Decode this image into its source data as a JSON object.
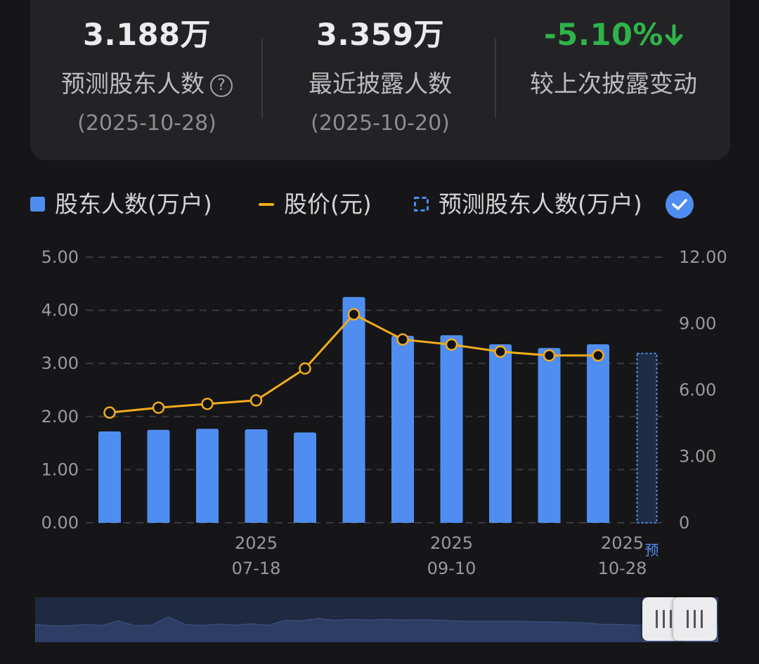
{
  "summary": {
    "forecast_holders": {
      "value": "3.188万",
      "label": "预测股东人数",
      "date": "(2025-10-28)",
      "help_icon": "question-circle-icon"
    },
    "latest_disclosed": {
      "value": "3.359万",
      "label": "最近披露人数",
      "date": "(2025-10-20)"
    },
    "change": {
      "value": "-5.10%",
      "label": "较上次披露变动",
      "icon": "arrow-down-icon",
      "color": "#2fb34a"
    }
  },
  "legend": {
    "bar_label": "股东人数(万户)",
    "line_label": "股价(元)",
    "forecast_label": "预测股东人数(万户)",
    "toggle_icon": "check-icon"
  },
  "colors": {
    "bar": "#4f8ef0",
    "line": "#f2ac1c",
    "forecast": "#4f8ef0",
    "toggle": "#4f8ef0"
  },
  "chart_data": {
    "type": "bar",
    "left_axis": {
      "ticks": [
        "5.00",
        "4.00",
        "3.00",
        "2.00",
        "1.00",
        "0.00"
      ],
      "ylim": [
        0,
        5
      ]
    },
    "right_axis": {
      "ticks": [
        "12.00",
        "9.00",
        "6.00",
        "3.00",
        "0"
      ],
      "ylim": [
        0,
        12
      ]
    },
    "x_labels": [
      {
        "year": "2025",
        "date": "07-18",
        "index": 3
      },
      {
        "year": "2025",
        "date": "09-10",
        "index": 7
      },
      {
        "year": "2025",
        "date": "10-28",
        "index": 11,
        "forecast_tag": "预"
      }
    ],
    "grid": true,
    "series": [
      {
        "name": "股东人数(万户)",
        "type": "bar",
        "values": [
          1.72,
          1.75,
          1.77,
          1.76,
          1.7,
          4.25,
          3.52,
          3.53,
          3.36,
          3.29,
          3.36
        ]
      },
      {
        "name": "股价(元)",
        "type": "line",
        "axis": "right",
        "values": [
          4.98,
          5.2,
          5.37,
          5.53,
          6.97,
          9.42,
          8.28,
          8.05,
          7.73,
          7.56,
          7.56
        ]
      },
      {
        "name": "预测股东人数(万户)",
        "type": "bar-forecast",
        "values": [
          null,
          null,
          null,
          null,
          null,
          null,
          null,
          null,
          null,
          null,
          null,
          3.188
        ]
      }
    ]
  },
  "navigator": {
    "area_values": [
      0.62,
      0.55,
      0.55,
      0.62,
      0.56,
      0.8,
      0.55,
      0.58,
      1.0,
      0.62,
      0.56,
      0.64,
      0.58,
      0.65,
      0.57,
      0.82,
      0.8,
      0.92,
      0.82,
      0.88,
      0.83,
      0.88,
      0.84,
      0.85,
      0.84,
      0.8,
      0.78,
      0.78,
      0.78,
      0.78,
      0.76,
      0.74,
      0.72,
      0.7,
      0.62,
      0.62,
      0.58,
      0.58,
      0.55,
      0.52,
      0.5,
      0.5
    ],
    "window_fraction": [
      0.89,
      1.0
    ]
  }
}
